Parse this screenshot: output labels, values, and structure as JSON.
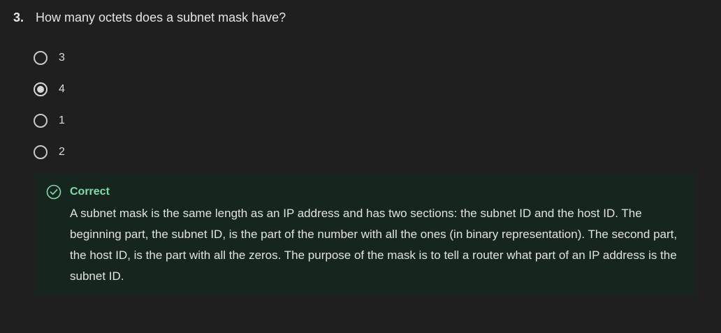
{
  "question": {
    "number": "3.",
    "text": "How many octets does a subnet mask have?"
  },
  "options": [
    {
      "label": "3",
      "selected": false
    },
    {
      "label": "4",
      "selected": true
    },
    {
      "label": "1",
      "selected": false
    },
    {
      "label": "2",
      "selected": false
    }
  ],
  "feedback": {
    "status": "Correct",
    "icon": "check-circle-icon",
    "text": "A subnet mask is the same length as an IP address and has two sections: the subnet ID and the host ID. The beginning part, the subnet ID, is the part of the number with all the ones (in binary representation). The second part, the host ID, is the part with all the zeros. The purpose of the mask is to tell a router what part of an IP address is the subnet ID."
  },
  "colors": {
    "background": "#1f1f1f",
    "feedback_background": "#16261f",
    "success": "#7fdca8"
  }
}
